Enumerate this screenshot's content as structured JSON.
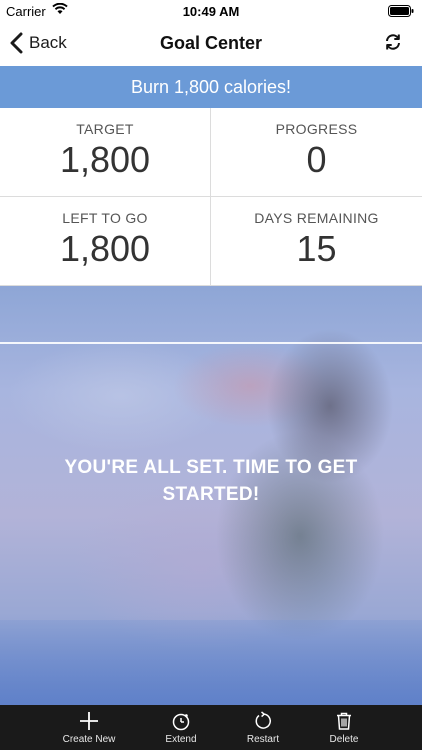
{
  "status_bar": {
    "carrier": "Carrier",
    "time": "10:49 AM"
  },
  "nav": {
    "back_label": "Back",
    "title": "Goal Center",
    "refresh_icon": "refresh-icon"
  },
  "banner": {
    "text": "Burn 1,800 calories!",
    "color": "#6b9ad7"
  },
  "stats": [
    {
      "label": "TARGET",
      "value": "1,800"
    },
    {
      "label": "PROGRESS",
      "value": "0"
    },
    {
      "label": "LEFT TO GO",
      "value": "1,800"
    },
    {
      "label": "DAYS REMAINING",
      "value": "15"
    }
  ],
  "hero": {
    "message": "YOU'RE ALL SET. TIME TO GET STARTED!"
  },
  "toolbar": {
    "items": [
      {
        "label": "Create New",
        "icon": "plus-icon"
      },
      {
        "label": "Extend",
        "icon": "stopwatch-icon"
      },
      {
        "label": "Restart",
        "icon": "restart-icon"
      },
      {
        "label": "Delete",
        "icon": "trash-icon"
      }
    ]
  }
}
